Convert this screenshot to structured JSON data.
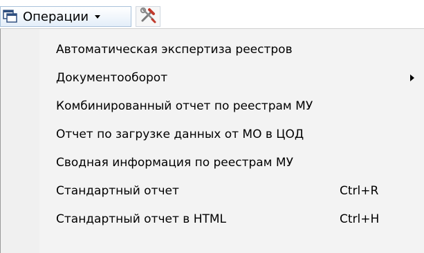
{
  "toolbar": {
    "operations_label": "Операции",
    "operations_icon": "windows-stack-icon",
    "dropdown_icon": "chevron-down-icon",
    "tools_icon": "tools-icon"
  },
  "menu": {
    "items": [
      {
        "label": "Автоматическая экспертиза реестров",
        "shortcut": "",
        "has_submenu": false
      },
      {
        "label": "Документооборот",
        "shortcut": "",
        "has_submenu": true
      },
      {
        "label": "Комбинированный отчет по реестрам МУ",
        "shortcut": "",
        "has_submenu": false
      },
      {
        "label": "Отчет по загрузке данных от МО в ЦОД",
        "shortcut": "",
        "has_submenu": false
      },
      {
        "label": "Сводная информация по реестрам МУ",
        "shortcut": "",
        "has_submenu": false
      },
      {
        "label": "Стандартный отчет",
        "shortcut": "Ctrl+R",
        "has_submenu": false
      },
      {
        "label": "Стандартный отчет в HTML",
        "shortcut": "Ctrl+H",
        "has_submenu": false
      }
    ]
  },
  "colors": {
    "menu_background": "#f3f3f3",
    "button_border": "#a9c1da",
    "tools_red": "#c0392b"
  }
}
